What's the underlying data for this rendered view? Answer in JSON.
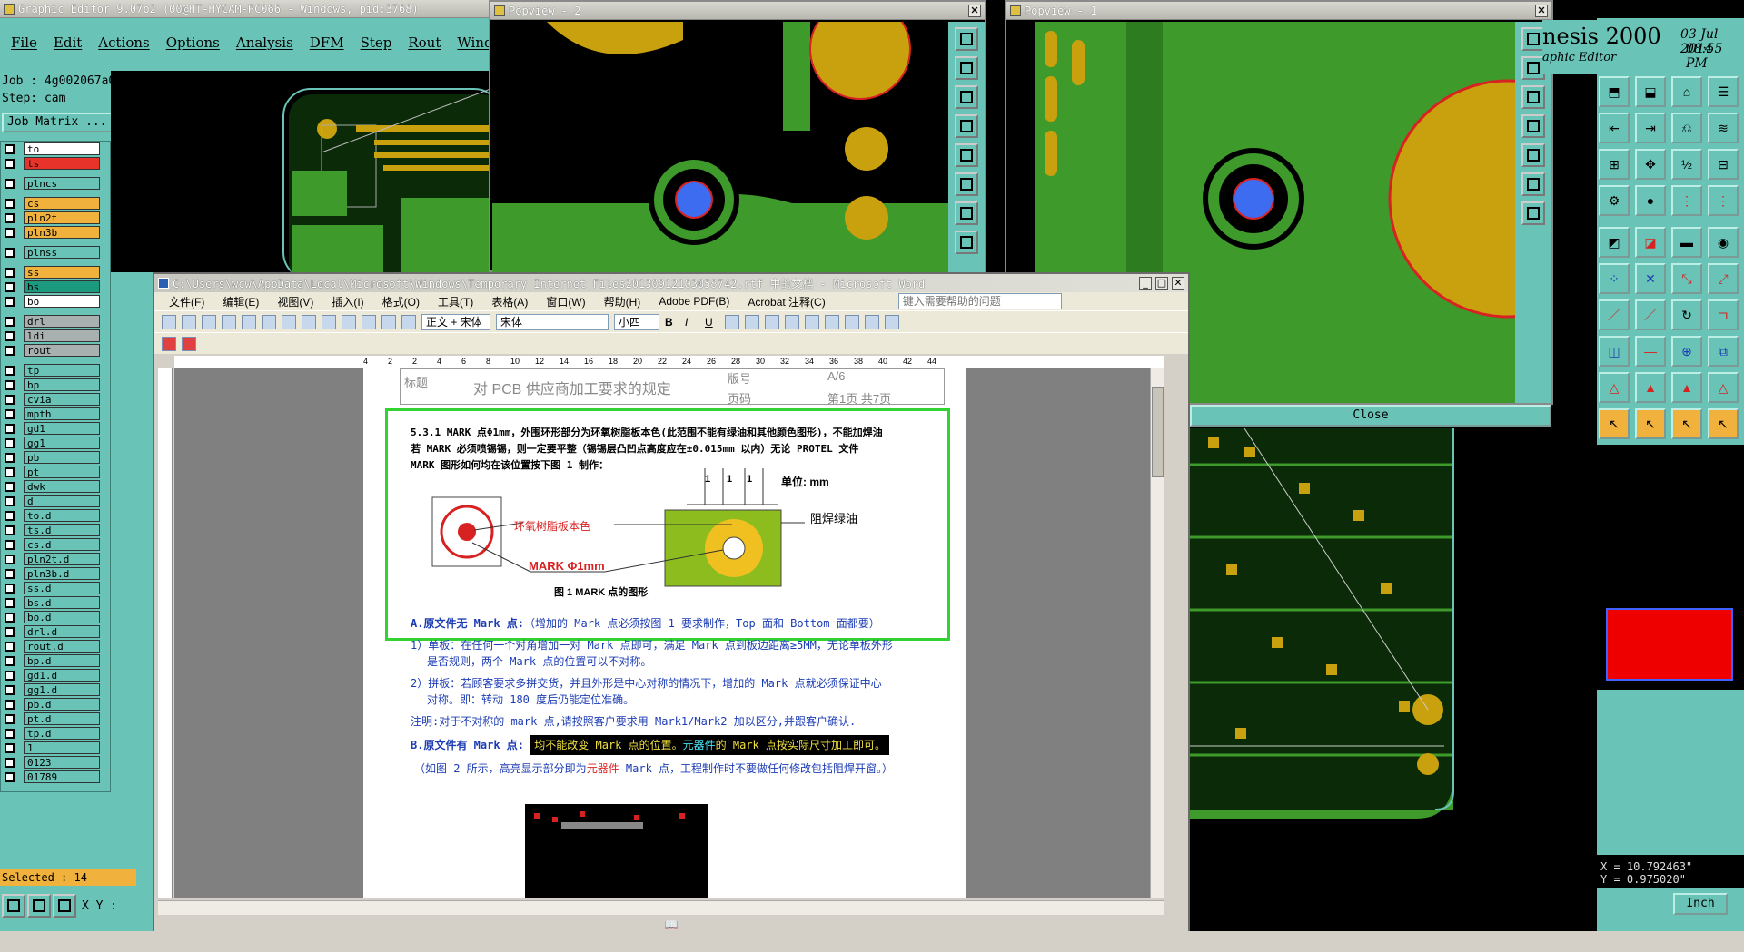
{
  "genesis": {
    "title": "Graphic Editor 9.07b2 (00@HT-HYCAM-PC066 - Windows, pid:3768)",
    "menu": [
      "File",
      "Edit",
      "Actions",
      "Options",
      "Analysis",
      "DFM",
      "Step",
      "Rout",
      "Windows"
    ],
    "job": "Job : 4g002067a0",
    "step": "Step: cam",
    "job_matrix": "Job Matrix ...",
    "brand": "nesis 2000",
    "brand_sub": "aphic Editor",
    "date": "03 Jul 2014",
    "time": "08:55 PM",
    "layers": [
      {
        "name": "to",
        "color": "#ffffff"
      },
      {
        "name": "ts",
        "color": "#e8332a"
      },
      {
        "sep": true
      },
      {
        "name": "plncs",
        "color": "#69c3b6"
      },
      {
        "sep": true
      },
      {
        "name": "cs",
        "color": "#f0b23c"
      },
      {
        "name": "pln2t",
        "color": "#f0b23c"
      },
      {
        "name": "pln3b",
        "color": "#f0b23c"
      },
      {
        "sep": true
      },
      {
        "name": "plnss",
        "color": "#69c3b6"
      },
      {
        "sep": true
      },
      {
        "name": "ss",
        "color": "#f0b23c"
      },
      {
        "name": "bs",
        "color": "#1b9a80"
      },
      {
        "name": "bo",
        "color": "#ffffff"
      },
      {
        "sep": true
      },
      {
        "name": "drl",
        "color": "#a8b0b0"
      },
      {
        "name": "ldi",
        "color": "#a8b0b0"
      },
      {
        "name": "rout",
        "color": "#a8b0b0"
      },
      {
        "sep": true
      },
      {
        "name": "tp",
        "color": "#69c3b6"
      },
      {
        "name": "bp",
        "color": "#69c3b6"
      },
      {
        "name": "cvia",
        "color": "#69c3b6"
      },
      {
        "name": "mpth",
        "color": "#69c3b6"
      },
      {
        "name": "gd1",
        "color": "#69c3b6"
      },
      {
        "name": "gg1",
        "color": "#69c3b6"
      },
      {
        "name": "pb",
        "color": "#69c3b6"
      },
      {
        "name": "pt",
        "color": "#69c3b6"
      },
      {
        "name": "dwk",
        "color": "#69c3b6"
      },
      {
        "name": "d",
        "color": "#69c3b6"
      },
      {
        "name": "to.d",
        "color": "#69c3b6"
      },
      {
        "name": "ts.d",
        "color": "#69c3b6"
      },
      {
        "name": "cs.d",
        "color": "#69c3b6"
      },
      {
        "name": "pln2t.d",
        "color": "#69c3b6"
      },
      {
        "name": "pln3b.d",
        "color": "#69c3b6"
      },
      {
        "name": "ss.d",
        "color": "#69c3b6"
      },
      {
        "name": "bs.d",
        "color": "#69c3b6"
      },
      {
        "name": "bo.d",
        "color": "#69c3b6"
      },
      {
        "name": "drl.d",
        "color": "#69c3b6"
      },
      {
        "name": "rout.d",
        "color": "#69c3b6"
      },
      {
        "name": "bp.d",
        "color": "#69c3b6"
      },
      {
        "name": "gd1.d",
        "color": "#69c3b6"
      },
      {
        "name": "gg1.d",
        "color": "#69c3b6"
      },
      {
        "name": "pb.d",
        "color": "#69c3b6"
      },
      {
        "name": "pt.d",
        "color": "#69c3b6"
      },
      {
        "name": "tp.d",
        "color": "#69c3b6"
      },
      {
        "name": "1",
        "color": "#69c3b6"
      },
      {
        "name": "0123",
        "color": "#69c3b6"
      },
      {
        "name": "01789",
        "color": "#69c3b6"
      }
    ],
    "selected": "Selected : 14",
    "xy_label": "X Y :",
    "coord_x": "X = 10.792463\"",
    "coord_y": "Y = 0.975020\"",
    "units": "Inch",
    "close_label": "Close"
  },
  "popview2": {
    "title": "Popview - 2"
  },
  "popview1": {
    "title": "Popview - 1"
  },
  "word": {
    "title": "C:\\Users\\wcw\\AppData\\Local\\Microsoft\\Windows\\Temporary Internet Files20130912103058742.rtf 中的文档 - Microsoft Word",
    "menu": [
      "文件(F)",
      "编辑(E)",
      "视图(V)",
      "插入(I)",
      "格式(O)",
      "工具(T)",
      "表格(A)",
      "窗口(W)",
      "帮助(H)",
      "Adobe PDF(B)",
      "Acrobat 注释(C)"
    ],
    "help_placeholder": "键入需要帮助的问题",
    "style": "正文 + 宋体",
    "font": "宋体",
    "size": "小四",
    "ruler": [
      "4",
      "2",
      "2",
      "4",
      "6",
      "8",
      "10",
      "12",
      "14",
      "16",
      "18",
      "20",
      "22",
      "24",
      "26",
      "28",
      "30",
      "32",
      "34",
      "36",
      "38",
      "40",
      "42",
      "44"
    ],
    "header_label": "标题",
    "header_title": "对 PCB 供应商加工要求的规定",
    "header_version_label": "版号",
    "header_version": "A/6",
    "header_page_label": "页码",
    "header_page": "第1页 共7页",
    "p1": "5.3.1 MARK 点Φ1mm，外围环形部分为环氧树脂板本色(此范围不能有绿油和其他颜色图形)，不能加焊油",
    "p2": "若 MARK 必须喷锡锡，则一定要平整（锡锡层凸凹点高度应在±0.015mm 以内）无论 PROTEL 文件",
    "p3": "MARK 图形如何均在该位置按下图 1 制作：",
    "unit_label": "单位: mm",
    "dim": "1",
    "label_resin": "环氧树脂板本色",
    "label_mask": "阻焊绿油",
    "label_mark": "MARK Φ1mm",
    "fig_caption": "图 1    MARK 点的图形",
    "a_title": "A.原文件无 Mark 点:",
    "a_text": "（增加的 Mark 点必须按图 1 要求制作，Top 面和 Bottom 面都要）",
    "a1": "1）单板：在任何一个对角增加一对 Mark 点即可，满足 Mark 点到板边距离≥5MM，无论单板外形",
    "a1b": "是否规则，两个 Mark 点的位置可以不对称。",
    "a2": "2）拼板：若顾客要求多拼交货，并且外形是中心对称的情况下，增加的 Mark 点就必须保证中心",
    "a2b": "对称。即：转动 180 度后仍能定位准确。",
    "note": "注明:对于不对称的 mark 点,请按照客户要求用 Mark1/Mark2 加以区分,并跟客户确认.",
    "b_title": "B.原文件有 Mark 点:",
    "b_text1": "均不能改变 Mark 点的位置。",
    "b_text2": "元器件",
    "b_text3": "的 Mark 点按实际尺寸加工即可。",
    "b_line": "（如图 2 所示，高亮显示部分即为",
    "b_line_red": "元器件",
    "b_line_end": " Mark 点，工程制作时不要做任何修改包括阻焊开窗。）"
  },
  "colors": {
    "teal": "#69c3b6",
    "pcb_green": "#3e9a2a",
    "pad_gold": "#c9a00e",
    "drill_blue": "#3d6cf0",
    "highlight": "#32d232"
  }
}
